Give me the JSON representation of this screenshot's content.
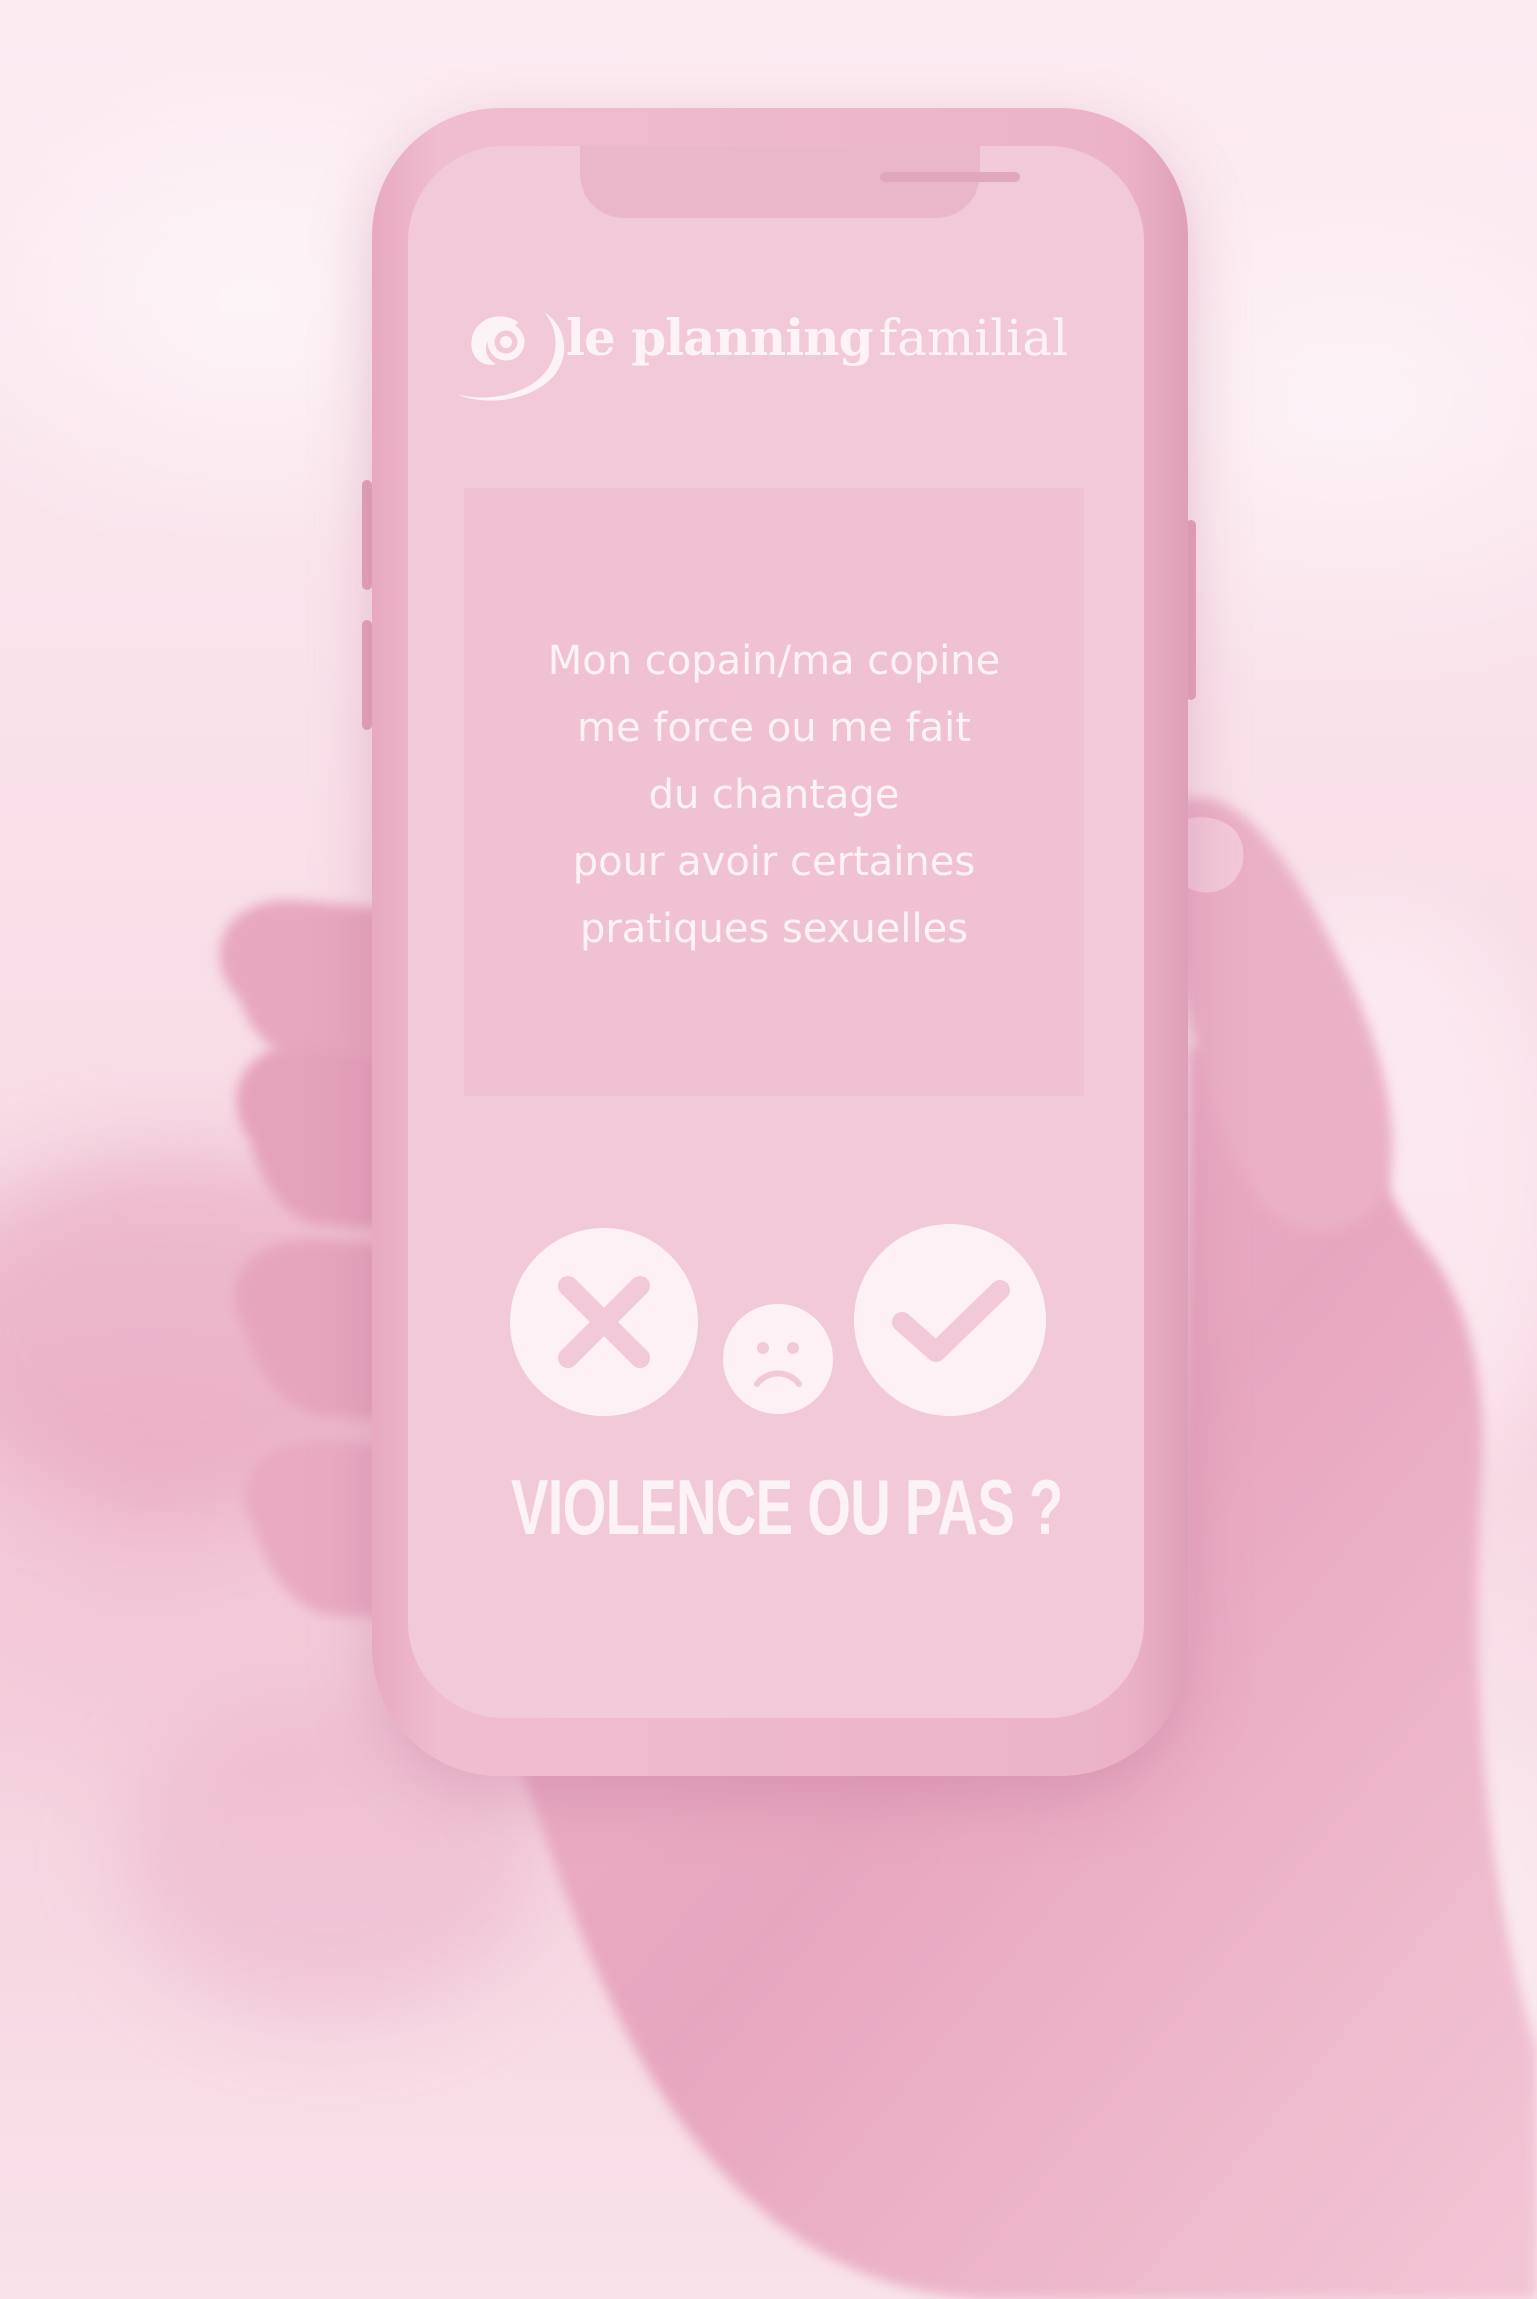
{
  "brand": {
    "name_bold": "le planning",
    "name_regular": "familial",
    "logo_icon": "planning-familial-swirl-icon"
  },
  "question": {
    "lines": [
      "Mon copain/ma copine",
      "me force ou me fait",
      "du chantage",
      "pour avoir certaines",
      "pratiques sexuelles"
    ]
  },
  "answers": {
    "no_icon": "cross-icon",
    "unsure_icon": "sad-face-icon",
    "yes_icon": "check-icon"
  },
  "tagline": "VIOLENCE OU PAS ?",
  "colors": {
    "tint": "#f2c9d8",
    "text": "#fdf2f6",
    "icon": "#f2c9d8"
  }
}
